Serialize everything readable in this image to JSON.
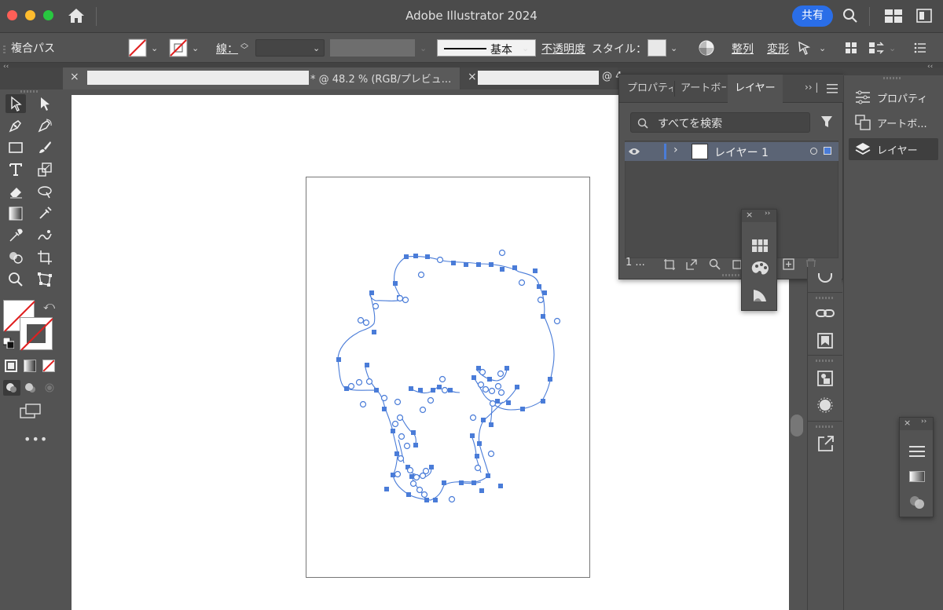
{
  "window": {
    "title": "Adobe Illustrator 2024",
    "share_label": "共有"
  },
  "controlbar": {
    "selection_type": "複合パス",
    "stroke_label": "線：",
    "brush_label": "基本",
    "opacity_label": "不透明度",
    "style_label": "スタイル：",
    "align_label": "整列",
    "transform_label": "変形"
  },
  "tabs": [
    {
      "label": "* @ 48.2 % (RGB/プレビュ..."
    },
    {
      "label": "@ 4"
    }
  ],
  "layers_panel": {
    "tabs": [
      "プロパティ",
      "アートボード",
      "レイヤー"
    ],
    "search_placeholder": "すべてを検索",
    "layers": [
      {
        "name": "レイヤー 1"
      }
    ],
    "footer_count": "1 ..."
  },
  "right_panel": {
    "items": [
      {
        "label": "プロパティ",
        "icon": "sliders-icon"
      },
      {
        "label": "アートボ...",
        "icon": "artboards-icon"
      },
      {
        "label": "レイヤー",
        "icon": "layers-icon"
      }
    ]
  },
  "colors": {
    "selection": "#4a7cd8",
    "share": "#2a6ee8",
    "layer_row": "#5b6475"
  }
}
